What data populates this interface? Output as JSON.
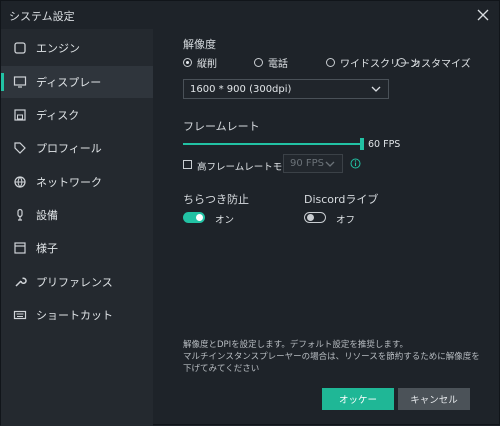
{
  "window": {
    "title": "システム設定"
  },
  "sidebar": {
    "items": [
      {
        "label": "エンジン",
        "icon": "engine-icon"
      },
      {
        "label": "ディスプレー",
        "icon": "monitor-icon",
        "active": true
      },
      {
        "label": "ディスク",
        "icon": "disk-icon"
      },
      {
        "label": "プロフィール",
        "icon": "tag-icon"
      },
      {
        "label": "ネットワーク",
        "icon": "globe-icon"
      },
      {
        "label": "設備",
        "icon": "microphone-icon"
      },
      {
        "label": "様子",
        "icon": "window-icon"
      },
      {
        "label": "プリファレンス",
        "icon": "wrench-icon"
      },
      {
        "label": "ショートカット",
        "icon": "keyboard-icon"
      }
    ]
  },
  "resolution": {
    "label": "解像度",
    "options": [
      "縦削",
      "電話",
      "ワイドスクリーン",
      "カスタマイズ"
    ],
    "selected": "縦削",
    "dropdown_value": "1600 * 900 (300dpi)"
  },
  "framerate": {
    "label": "フレームレート",
    "value_label": "60 FPS",
    "high_fps_label": "高フレームレートモード",
    "high_fps_value": "90 FPS",
    "high_fps_checked": false
  },
  "anti_flicker": {
    "label": "ちらつき防止",
    "state_label": "オン",
    "on": true
  },
  "discord": {
    "label": "Discordライブ",
    "state_label": "オフ",
    "on": false
  },
  "notes": {
    "line1": "解像度とDPIを設定します。デフォルト設定を推奨します。",
    "line2": "マルチインスタンスプレーヤーの場合は、リソースを節約するために解像度を下げてみてください"
  },
  "buttons": {
    "ok": "オッケー",
    "cancel": "キャンセル"
  },
  "colors": {
    "accent": "#22c2a4",
    "background": "#1e2329",
    "sidebar": "#24292f"
  }
}
